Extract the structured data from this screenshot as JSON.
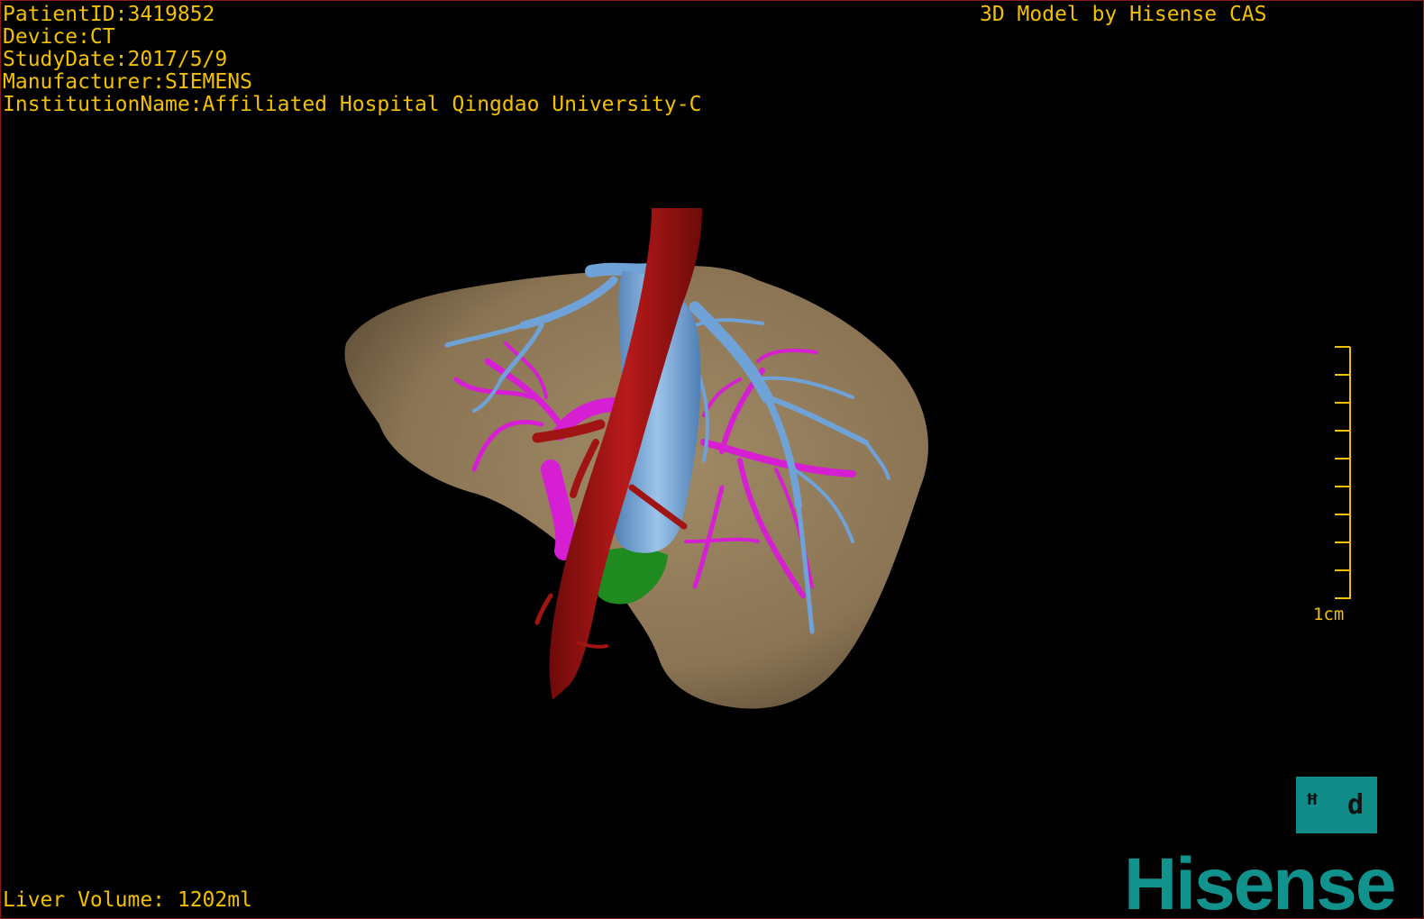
{
  "header": {
    "patient_id": "PatientID:3419852",
    "device": "Device:CT",
    "study_date": "StudyDate:2017/5/9",
    "manufacturer": "Manufacturer:SIEMENS",
    "institution": "InstitutionName:Affiliated Hospital Qingdao University-C",
    "model_credit": "3D Model by Hisense CAS"
  },
  "footer": {
    "liver_volume": "Liver Volume: 1202ml"
  },
  "scale": {
    "label": "1cm"
  },
  "orientation": {
    "label": "ꟸ d"
  },
  "brand": {
    "logo_text": "Hisense"
  },
  "colors": {
    "overlay_text": "#f2c000",
    "liver": "#8a7454",
    "hepatic_vein": "#6fa3d8",
    "portal_vein": "#d61fd2",
    "aorta": "#a01414",
    "gallbladder": "#1f8a1f",
    "brand": "#12928d",
    "border": "#8a1a1a"
  },
  "structures": [
    "liver-surface",
    "hepatic-vein",
    "portal-vein",
    "aorta",
    "gallbladder"
  ]
}
